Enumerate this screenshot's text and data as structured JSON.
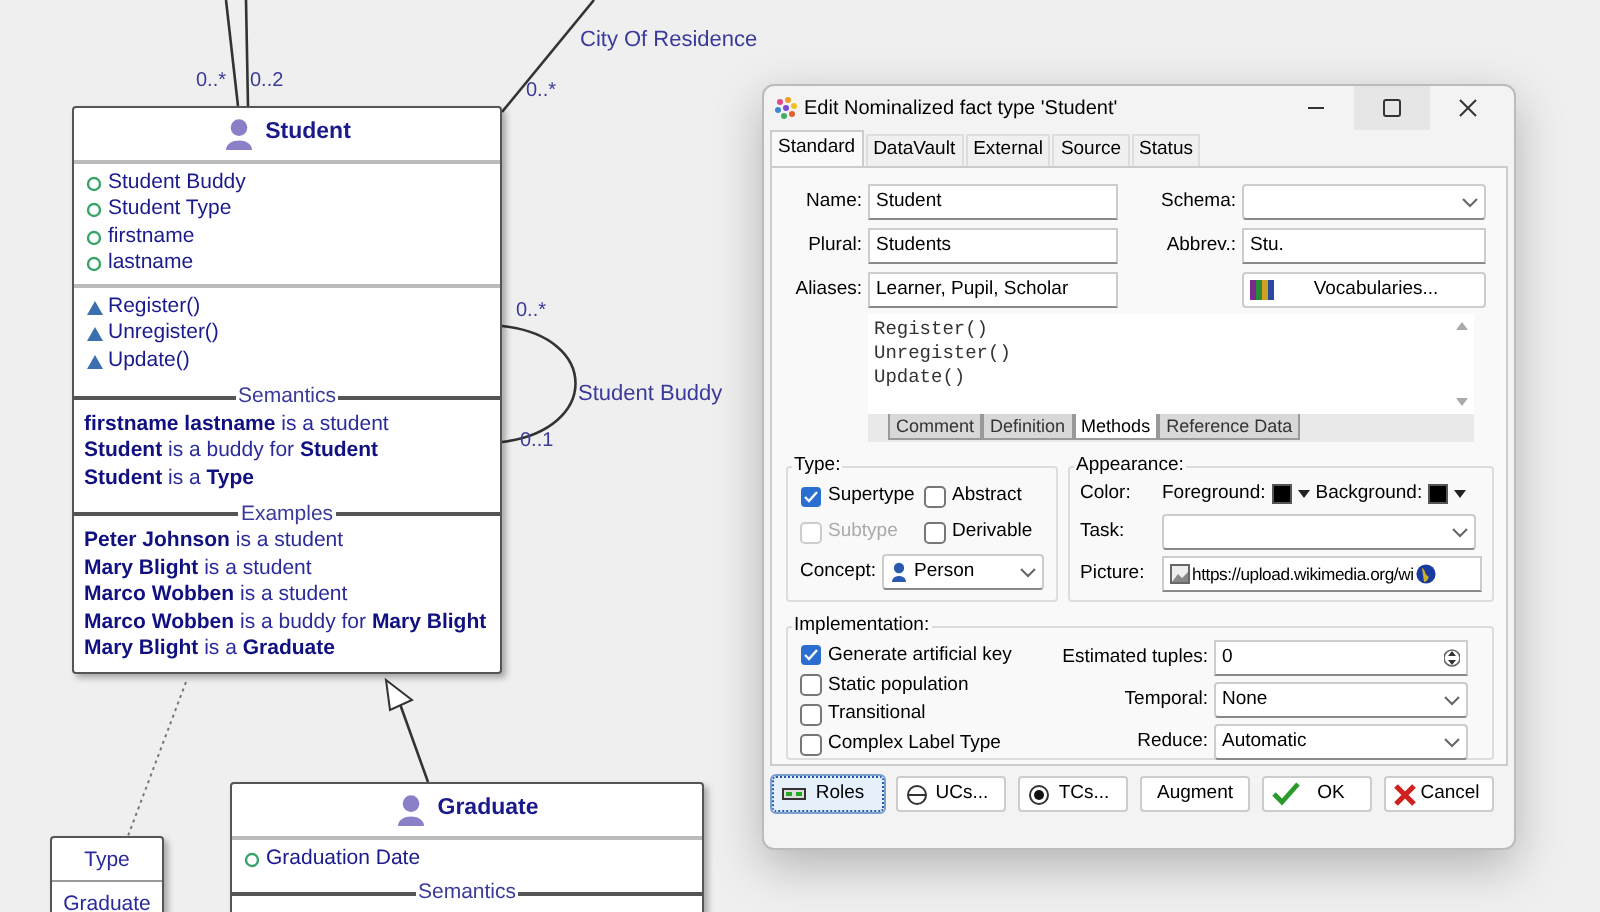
{
  "diagram": {
    "entities": [
      {
        "name": "Student",
        "attributes": [
          "Student Buddy",
          "Student Type",
          "firstname",
          "lastname"
        ],
        "methods": [
          "Register()",
          "Unregister()",
          "Update()"
        ],
        "sections": [
          {
            "title": "Semantics",
            "rows": [
              "**firstname lastname** is a student",
              "**Student** is a buddy for **Student**",
              "**Student** is a **Type**"
            ]
          },
          {
            "title": "Examples",
            "rows": [
              "**Peter Johnson** is a student",
              "**Mary Blight** is a student",
              "**Marco Wobben** is a student",
              "**Marco Wobben** is a buddy for **Mary Blight**",
              "**Mary Blight** is a **Graduate**"
            ]
          }
        ]
      },
      {
        "name": "Graduate",
        "attributes": [
          "Graduation Date"
        ],
        "sections": [
          {
            "title": "Semantics"
          }
        ]
      }
    ],
    "type_box": {
      "title": "Type",
      "items": [
        "Graduate"
      ]
    },
    "associations": [
      {
        "roles": [
          "0..*"
        ]
      },
      {
        "roles": [
          "0..2"
        ]
      },
      {
        "name": "City Of Residence",
        "roles": [
          "0..*"
        ]
      },
      {
        "name": "Student Buddy",
        "roles": [
          "0..*",
          "0..1"
        ]
      }
    ]
  },
  "dialog": {
    "title": "Edit Nominalized fact type 'Student'",
    "tabs": [
      {
        "label": "Standard",
        "selected": true
      },
      {
        "label": "DataVault",
        "selected": false
      },
      {
        "label": "External",
        "selected": false
      },
      {
        "label": "Source",
        "selected": false
      },
      {
        "label": "Status",
        "selected": false
      }
    ],
    "name": {
      "label": "Name:",
      "value": "Student"
    },
    "plural": {
      "label": "Plural:",
      "value": "Students"
    },
    "aliases": {
      "label": "Aliases:",
      "value": "Learner, Pupil, Scholar"
    },
    "schema": {
      "label": "Schema:"
    },
    "abbrev": {
      "label": "Abbrev.:",
      "value": "Stu."
    },
    "vocabularies_button": "Vocabularies...",
    "memo_lines": [
      "Register()",
      "Unregister()",
      "Update()"
    ],
    "memo_tabs": [
      {
        "label": "Comment",
        "selected": false
      },
      {
        "label": "Definition",
        "selected": false
      },
      {
        "label": "Methods",
        "selected": true
      },
      {
        "label": "Reference Data",
        "selected": false
      }
    ],
    "type_group": {
      "title": "Type:",
      "checkboxes": [
        {
          "label": "Supertype",
          "checked": true,
          "disabled": false
        },
        {
          "label": "Abstract",
          "checked": false,
          "disabled": false
        },
        {
          "label": "Subtype",
          "checked": false,
          "disabled": true
        },
        {
          "label": "Derivable",
          "checked": false,
          "disabled": false
        }
      ],
      "concept": {
        "label": "Concept:",
        "value": "Person"
      }
    },
    "appearance": {
      "title": "Appearance:",
      "color_label": "Color:",
      "foreground": {
        "label": "Foreground:",
        "color": "#000000"
      },
      "background": {
        "label": "Background:",
        "color": "#000000"
      },
      "task": {
        "label": "Task:"
      },
      "picture": {
        "label": "Picture:",
        "value": "https://upload.wikimedia.org/wi"
      }
    },
    "implementation": {
      "title": "Implementation:",
      "checkboxes": [
        {
          "label": "Generate artificial key",
          "checked": true
        },
        {
          "label": "Static population",
          "checked": false
        },
        {
          "label": "Transitional",
          "checked": false
        },
        {
          "label": "Complex Label Type",
          "checked": false
        }
      ],
      "estimated_tuples": {
        "label": "Estimated tuples:",
        "value": "0"
      },
      "temporal": {
        "label": "Temporal:",
        "value": "None"
      },
      "reduce": {
        "label": "Reduce:",
        "value": "Automatic"
      }
    },
    "buttons": [
      {
        "label": "Roles",
        "focused": true
      },
      {
        "label": "UCs...",
        "focused": false
      },
      {
        "label": "TCs...",
        "focused": false
      },
      {
        "label": "Augment",
        "focused": false
      },
      {
        "label": "OK",
        "focused": false
      },
      {
        "label": "Cancel",
        "focused": false
      }
    ]
  }
}
